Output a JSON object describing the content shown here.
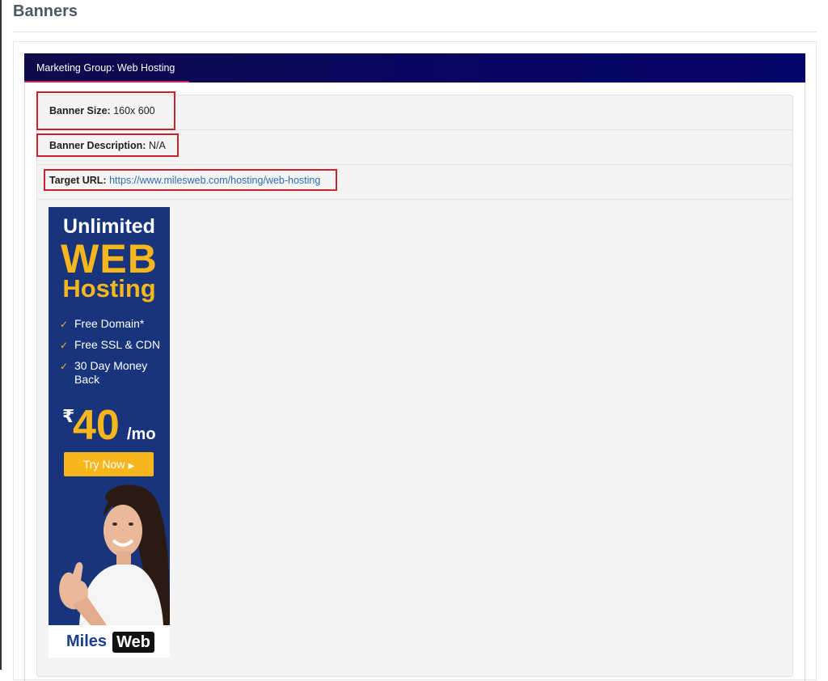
{
  "page": {
    "title": "Banners"
  },
  "group": {
    "title": "Marketing Group: Web Hosting"
  },
  "banner": {
    "size_label": "Banner Size:",
    "size_value": "160x 600",
    "description_label": "Banner Description:",
    "description_value": "N/A",
    "target_label": "Target URL:",
    "target_value": "https://www.milesweb.com/hosting/web-hosting"
  },
  "ad": {
    "line1": "Unlimited",
    "line2": "WEB",
    "line3": "Hosting",
    "features": [
      "Free Domain*",
      "Free SSL & CDN",
      "30 Day Money Back"
    ],
    "currency": "₹",
    "price": "40",
    "per": "/mo",
    "cta": "Try Now",
    "logo_part1": "Miles",
    "logo_part2": "Web"
  },
  "colors": {
    "header_bg": "#080760",
    "header_accent": "#c42b5a",
    "highlight_border": "#c8232c",
    "link": "#2b6fb0",
    "ad_bg": "#17347d",
    "ad_gold": "#f7b71c"
  }
}
